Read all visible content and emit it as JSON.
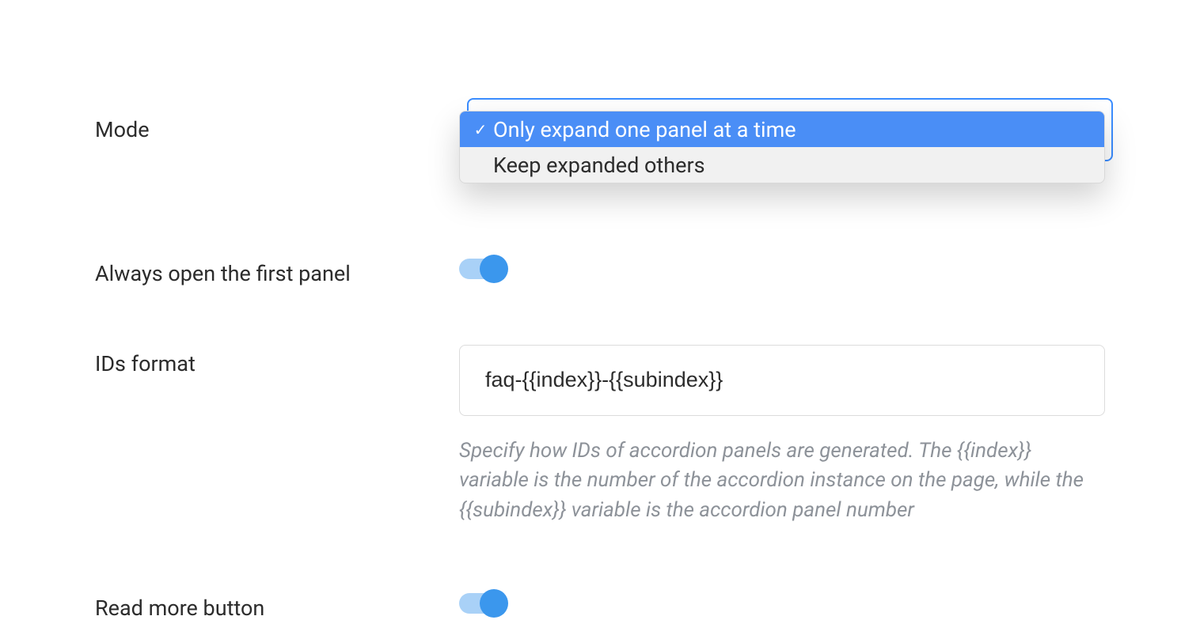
{
  "form": {
    "mode": {
      "label": "Mode",
      "options": [
        "Only expand one panel at a time",
        "Keep expanded others"
      ],
      "selected_index": 0
    },
    "always_open_first": {
      "label": "Always open the first panel",
      "value": true
    },
    "ids_format": {
      "label": "IDs format",
      "value": "faq-{{index}}-{{subindex}}",
      "help": "Specify how IDs of accordion panels are generated. The {{index}} variable is the number of the accordion instance on the page, while the {{subindex}} variable is the accordion panel number"
    },
    "read_more_button": {
      "label": "Read more button",
      "value": true
    }
  }
}
